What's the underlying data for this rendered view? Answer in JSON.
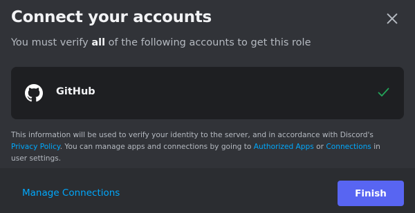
{
  "dialog": {
    "title": "Connect your accounts",
    "subtitle_before": "You must verify ",
    "subtitle_strong": "all",
    "subtitle_after": " of the following accounts to get this role"
  },
  "accounts": [
    {
      "name": "GitHub",
      "icon": "github-icon",
      "status": "verified-check-icon"
    }
  ],
  "disclaimer": {
    "text_1": "This information will be used to verify your identity to the server, and in accordance with Discord's ",
    "link_privacy": "Privacy Policy",
    "text_2": ". You can manage apps and connections by going to ",
    "link_authorized_apps": "Authorized Apps",
    "text_3": " or ",
    "link_connections": "Connections",
    "text_4": " in user settings."
  },
  "footer": {
    "manage_label": "Manage Connections",
    "finish_label": "Finish"
  },
  "colors": {
    "background": "#313338",
    "footer_background": "#2b2d31",
    "card_background": "#1e1f22",
    "link": "#00a8fc",
    "brand_button": "#5865f2",
    "check_green": "#23a559"
  }
}
